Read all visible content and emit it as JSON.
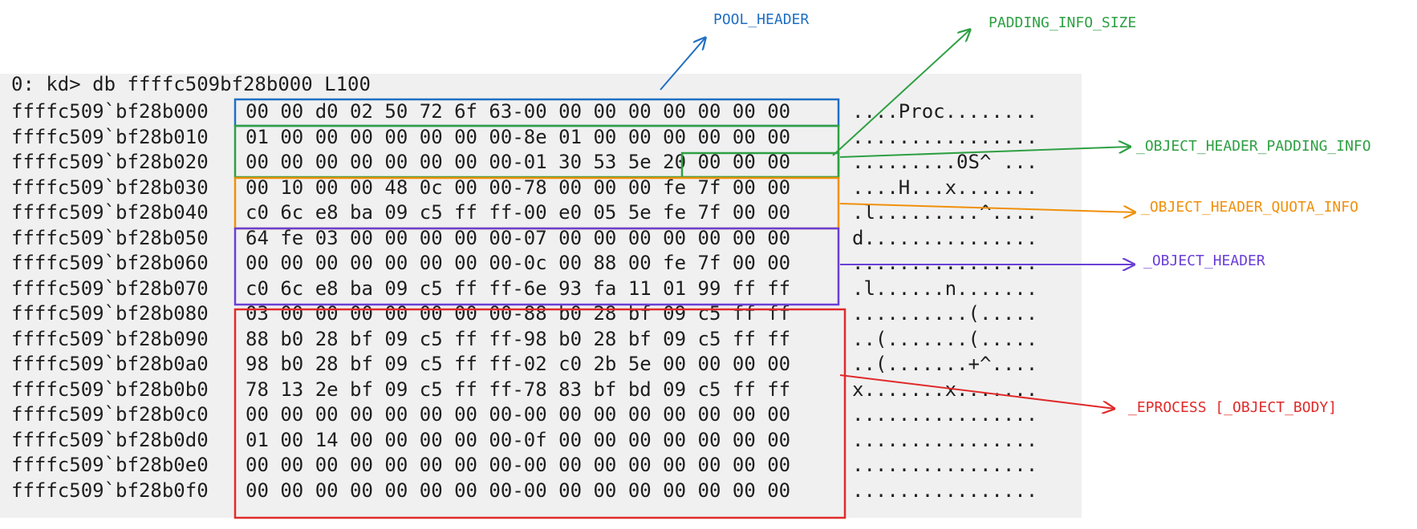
{
  "command": "0: kd> db ffffc509bf28b000 L100",
  "rows": [
    {
      "addr": "ffffc509`bf28b000",
      "hex": "00 00 d0 02 50 72 6f 63-00 00 00 00 00 00 00 00",
      "ascii": "....Proc........"
    },
    {
      "addr": "ffffc509`bf28b010",
      "hex": "01 00 00 00 00 00 00 00-8e 01 00 00 00 00 00 00",
      "ascii": "................"
    },
    {
      "addr": "ffffc509`bf28b020",
      "hex": "00 00 00 00 00 00 00 00-01 30 53 5e 20 00 00 00",
      "ascii": ".........0S^ ..."
    },
    {
      "addr": "ffffc509`bf28b030",
      "hex": "00 10 00 00 48 0c 00 00-78 00 00 00 fe 7f 00 00",
      "ascii": "....H...x......."
    },
    {
      "addr": "ffffc509`bf28b040",
      "hex": "c0 6c e8 ba 09 c5 ff ff-00 e0 05 5e fe 7f 00 00",
      "ascii": ".l.........^...."
    },
    {
      "addr": "ffffc509`bf28b050",
      "hex": "64 fe 03 00 00 00 00 00-07 00 00 00 00 00 00 00",
      "ascii": "d..............."
    },
    {
      "addr": "ffffc509`bf28b060",
      "hex": "00 00 00 00 00 00 00 00-0c 00 88 00 fe 7f 00 00",
      "ascii": "................"
    },
    {
      "addr": "ffffc509`bf28b070",
      "hex": "c0 6c e8 ba 09 c5 ff ff-6e 93 fa 11 01 99 ff ff",
      "ascii": ".l......n......."
    },
    {
      "addr": "ffffc509`bf28b080",
      "hex": "03 00 00 00 00 00 00 00-88 b0 28 bf 09 c5 ff ff",
      "ascii": "..........(....."
    },
    {
      "addr": "ffffc509`bf28b090",
      "hex": "88 b0 28 bf 09 c5 ff ff-98 b0 28 bf 09 c5 ff ff",
      "ascii": "..(.......(....."
    },
    {
      "addr": "ffffc509`bf28b0a0",
      "hex": "98 b0 28 bf 09 c5 ff ff-02 c0 2b 5e 00 00 00 00",
      "ascii": "..(.......+^...."
    },
    {
      "addr": "ffffc509`bf28b0b0",
      "hex": "78 13 2e bf 09 c5 ff ff-78 83 bf bd 09 c5 ff ff",
      "ascii": "x.......x......."
    },
    {
      "addr": "ffffc509`bf28b0c0",
      "hex": "00 00 00 00 00 00 00 00-00 00 00 00 00 00 00 00",
      "ascii": "................"
    },
    {
      "addr": "ffffc509`bf28b0d0",
      "hex": "01 00 14 00 00 00 00 00-0f 00 00 00 00 00 00 00",
      "ascii": "................"
    },
    {
      "addr": "ffffc509`bf28b0e0",
      "hex": "00 00 00 00 00 00 00 00-00 00 00 00 00 00 00 00",
      "ascii": "................"
    },
    {
      "addr": "ffffc509`bf28b0f0",
      "hex": "00 00 00 00 00 00 00 00-00 00 00 00 00 00 00 00",
      "ascii": "................"
    }
  ],
  "annotations": {
    "pool_header": {
      "text": "POOL_HEADER",
      "color": "#1f6fc4"
    },
    "padding_info_size": {
      "text": "PADDING_INFO_SIZE",
      "color": "#2ea043"
    },
    "object_header_padding_info": {
      "text": "_OBJECT_HEADER_PADDING_INFO",
      "color": "#2ea043"
    },
    "object_header_quota_info": {
      "text": "_OBJECT_HEADER_QUOTA_INFO",
      "color": "#f0900a"
    },
    "object_header": {
      "text": "_OBJECT_HEADER",
      "color": "#6a3fd6"
    },
    "eprocess": {
      "text": "_EPROCESS [_OBJECT_BODY]",
      "color": "#e02a2a"
    }
  }
}
